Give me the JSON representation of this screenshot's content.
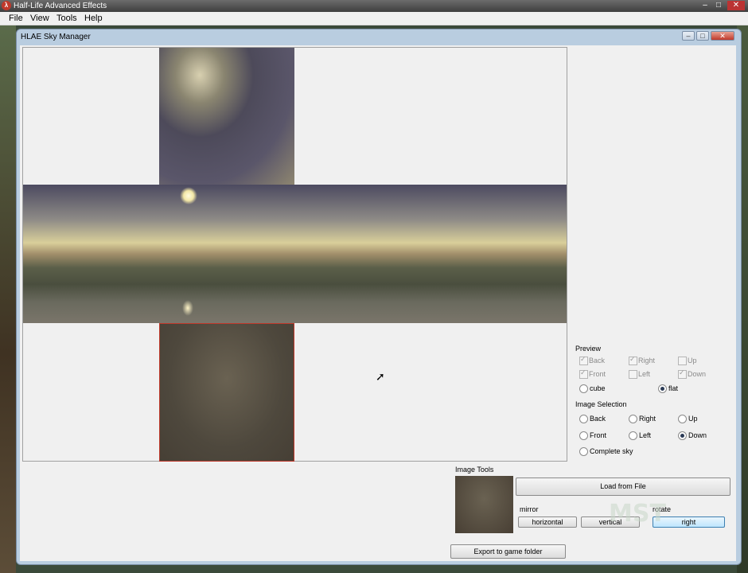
{
  "app": {
    "title": "Half-Life Advanced Effects",
    "icon_letter": "λ",
    "window_controls": [
      "–",
      "□",
      "✕"
    ]
  },
  "menu": [
    "File",
    "View",
    "Tools",
    "Help"
  ],
  "dialog": {
    "title": "HLAE Sky Manager",
    "controls": [
      "–",
      "□",
      "✕"
    ]
  },
  "preview": {
    "label": "Preview",
    "checkboxes": [
      {
        "label": "Back",
        "checked": true
      },
      {
        "label": "Right",
        "checked": true
      },
      {
        "label": "Up",
        "checked": false
      },
      {
        "label": "Front",
        "checked": true
      },
      {
        "label": "Left",
        "checked": false
      },
      {
        "label": "Down",
        "checked": true
      }
    ],
    "modes": [
      {
        "label": "cube",
        "selected": false
      },
      {
        "label": "flat",
        "selected": true
      }
    ]
  },
  "image_selection": {
    "label": "Image Selection",
    "options": [
      {
        "label": "Back",
        "selected": false
      },
      {
        "label": "Right",
        "selected": false
      },
      {
        "label": "Up",
        "selected": false
      },
      {
        "label": "Front",
        "selected": false
      },
      {
        "label": "Left",
        "selected": false
      },
      {
        "label": "Down",
        "selected": true
      },
      {
        "label": "Complete sky",
        "selected": false
      }
    ]
  },
  "image_tools": {
    "label": "Image Tools",
    "load_label": "Load from File",
    "mirror_label": "mirror",
    "horizontal_label": "horizontal",
    "vertical_label": "vertical",
    "rotate_label": "rotate",
    "right_label": "right"
  },
  "export_label": "Export to game folder",
  "watermark": "MST"
}
